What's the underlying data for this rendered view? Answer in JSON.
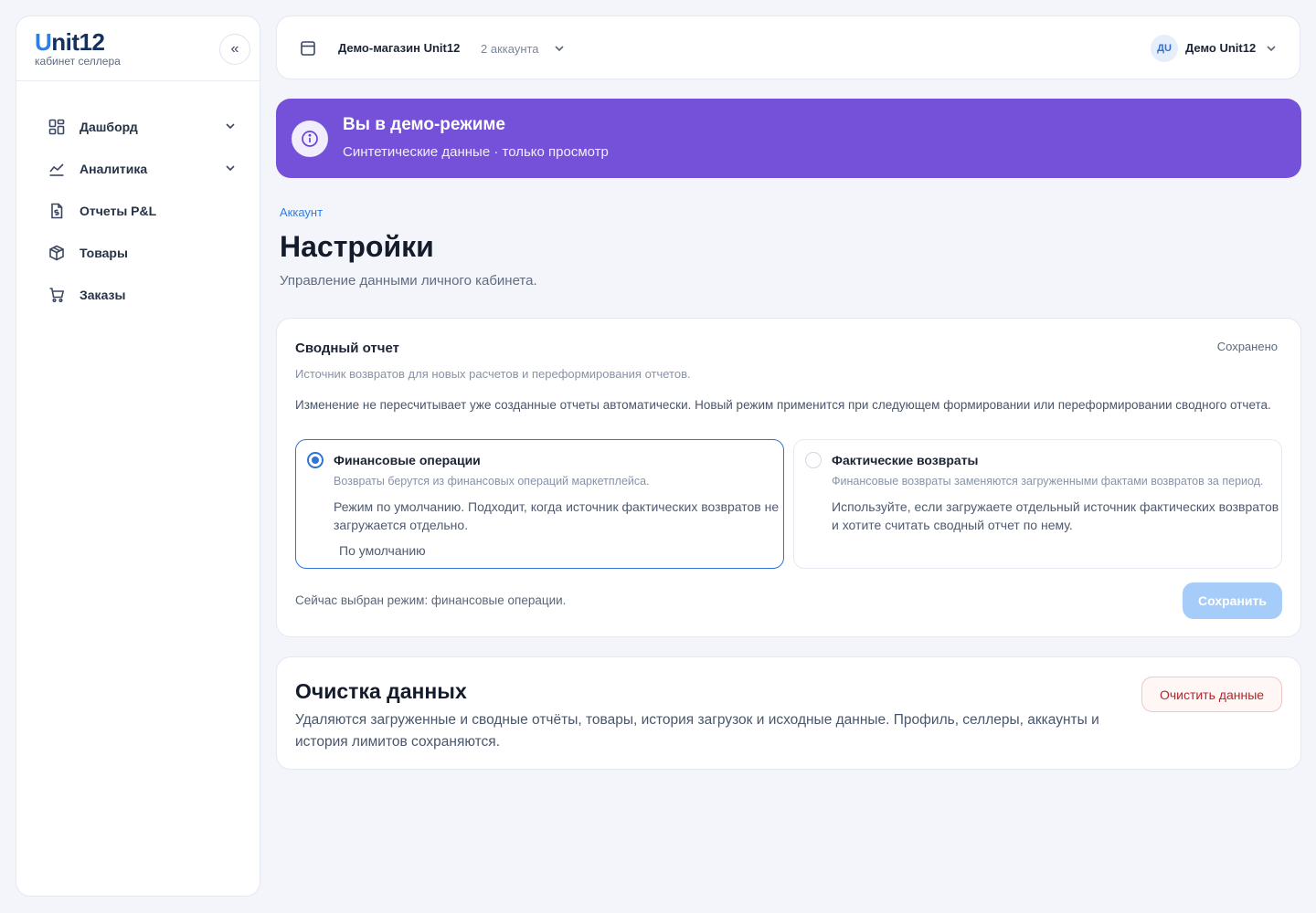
{
  "sidebar": {
    "logo_u": "U",
    "logo_rest": "nit12",
    "subtitle": "кабинет селлера",
    "collapse_glyph": "«",
    "items": [
      {
        "label": "Дашборд",
        "icon": "dashboard-icon",
        "has_submenu": true
      },
      {
        "label": "Аналитика",
        "icon": "chart-line-icon",
        "has_submenu": true
      },
      {
        "label": "Отчеты P&L",
        "icon": "report-dollar-icon",
        "has_submenu": false
      },
      {
        "label": "Товары",
        "icon": "box-icon",
        "has_submenu": false
      },
      {
        "label": "Заказы",
        "icon": "cart-icon",
        "has_submenu": false
      }
    ]
  },
  "topbar": {
    "shop_name": "Демо-магазин Unit12",
    "accounts": "2 аккаунта",
    "user_initials": "ДU",
    "user_name": "Демо Unit12"
  },
  "banner": {
    "title": "Вы в демо-режиме",
    "subtitle": "Синтетические данные · только просмотр",
    "color": "#7551d9"
  },
  "page": {
    "breadcrumb": "Аккаунт",
    "title": "Настройки",
    "subtitle": "Управление данными личного кабинета."
  },
  "summary_card": {
    "title": "Сводный отчет",
    "status": "Сохранено",
    "description": "Источник возвратов для новых расчетов и переформирования отчетов.",
    "note": "Изменение не пересчитывает уже созданные отчеты автоматически. Новый режим применится при следующем формировании или переформировании сводного отчета.",
    "options": [
      {
        "title": "Финансовые операции",
        "description": "Возвраты берутся из финансовых операций маркетплейса.",
        "text": "Режим по умолчанию. Подходит, когда источник фактических возвратов не загружается отдельно.",
        "default_label": "По умолчанию",
        "selected": true
      },
      {
        "title": "Фактические возвраты",
        "description": "Финансовые возвраты заменяются загруженными фактами возвратов за период.",
        "text": "Используйте, если загружаете отдельный источник фактических возвратов и хотите считать сводный отчет по нему.",
        "selected": false
      }
    ],
    "current_mode": "Сейчас выбран режим: финансовые операции.",
    "save_label": "Сохранить",
    "accent": "#2f74d6"
  },
  "clear_card": {
    "title": "Очистка данных",
    "description": "Удаляются загруженные и сводные отчёты, товары, история загрузок и исходные данные. Профиль, селлеры, аккаунты и история лимитов сохраняются.",
    "button_label": "Очистить данные",
    "danger_color": "#b3262a"
  }
}
